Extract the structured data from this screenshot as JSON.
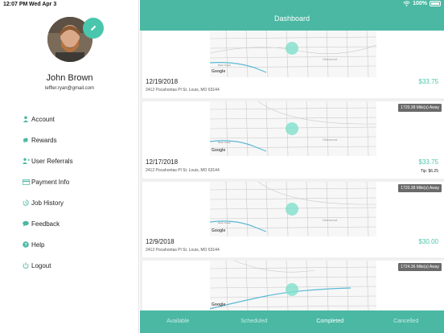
{
  "status_bar": {
    "time": "12:07 PM",
    "date": "Wed Apr 3",
    "battery": "100%"
  },
  "profile": {
    "name": "John Brown",
    "email": "leffler.ryan@gmail.com"
  },
  "menu": [
    {
      "label": "Account",
      "icon": "person-icon"
    },
    {
      "label": "Rewards",
      "icon": "megaphone-icon"
    },
    {
      "label": "User Referrals",
      "icon": "user-plus-icon"
    },
    {
      "label": "Payment Info",
      "icon": "credit-card-icon"
    },
    {
      "label": "Job History",
      "icon": "history-icon"
    },
    {
      "label": "Feedback",
      "icon": "chat-bubble-icon"
    },
    {
      "label": "Help",
      "icon": "question-icon"
    },
    {
      "label": "Logout",
      "icon": "power-icon"
    }
  ],
  "header": {
    "title": "Dashboard"
  },
  "jobs": [
    {
      "date": "12/19/2018",
      "address": "2412 Pocahontas Pl St. Louis, MO 63144",
      "amount": "$33.75",
      "distance": "",
      "tip": ""
    },
    {
      "date": "12/17/2018",
      "address": "2412 Pocahontas Pl St. Louis, MO 63144",
      "amount": "$33.75",
      "distance": "1720.38 Mile(s) Away",
      "tip": "Tip: $6.25"
    },
    {
      "date": "12/9/2018",
      "address": "2412 Pocahontas Pl St. Louis, MO 63144",
      "amount": "$30.00",
      "distance": "1720.38 Mile(s) Away",
      "tip": ""
    },
    {
      "date": "",
      "address": "",
      "amount": "",
      "distance": "1724.36 Mile(s) Away",
      "tip": ""
    }
  ],
  "map": {
    "google_label": "Google",
    "neighborhood": "Glenwood",
    "street": "River Creek"
  },
  "tabs": [
    "Available",
    "Scheduled",
    "Completed",
    "Cancelled"
  ],
  "active_tab": "Completed",
  "colors": {
    "accent": "#4ab8a3",
    "amount": "#4ac6ad",
    "marker": "#7fe0cc"
  }
}
